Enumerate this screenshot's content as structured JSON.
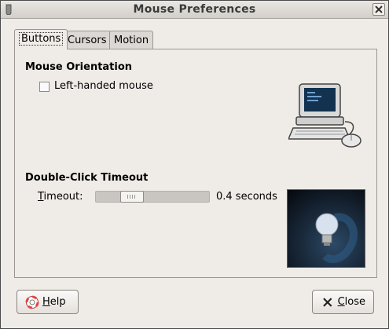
{
  "window": {
    "title": "Mouse Preferences"
  },
  "tabs": [
    {
      "label": "Buttons",
      "active": true
    },
    {
      "label": "Cursors",
      "active": false
    },
    {
      "label": "Motion",
      "active": false
    }
  ],
  "orientation": {
    "section_title": "Mouse Orientation",
    "checkbox_label": "Left-handed mouse",
    "checked": false
  },
  "double_click": {
    "section_title": "Double-Click Timeout",
    "timeout_label": "Timeout:",
    "value_text": "0.4 seconds",
    "slider_fraction": 0.27
  },
  "footer": {
    "help_label": "Help",
    "close_label": "Close"
  },
  "icons": {
    "window": "window-menu-icon",
    "close_window": "close-icon",
    "computer": "computer-mouse-icon",
    "lightbulb": "lightbulb-icon",
    "help": "help-lifebuoy-icon",
    "close": "close-icon"
  },
  "colors": {
    "window_bg": "#efebe7",
    "test_area_bg": "#1a2a3c"
  }
}
